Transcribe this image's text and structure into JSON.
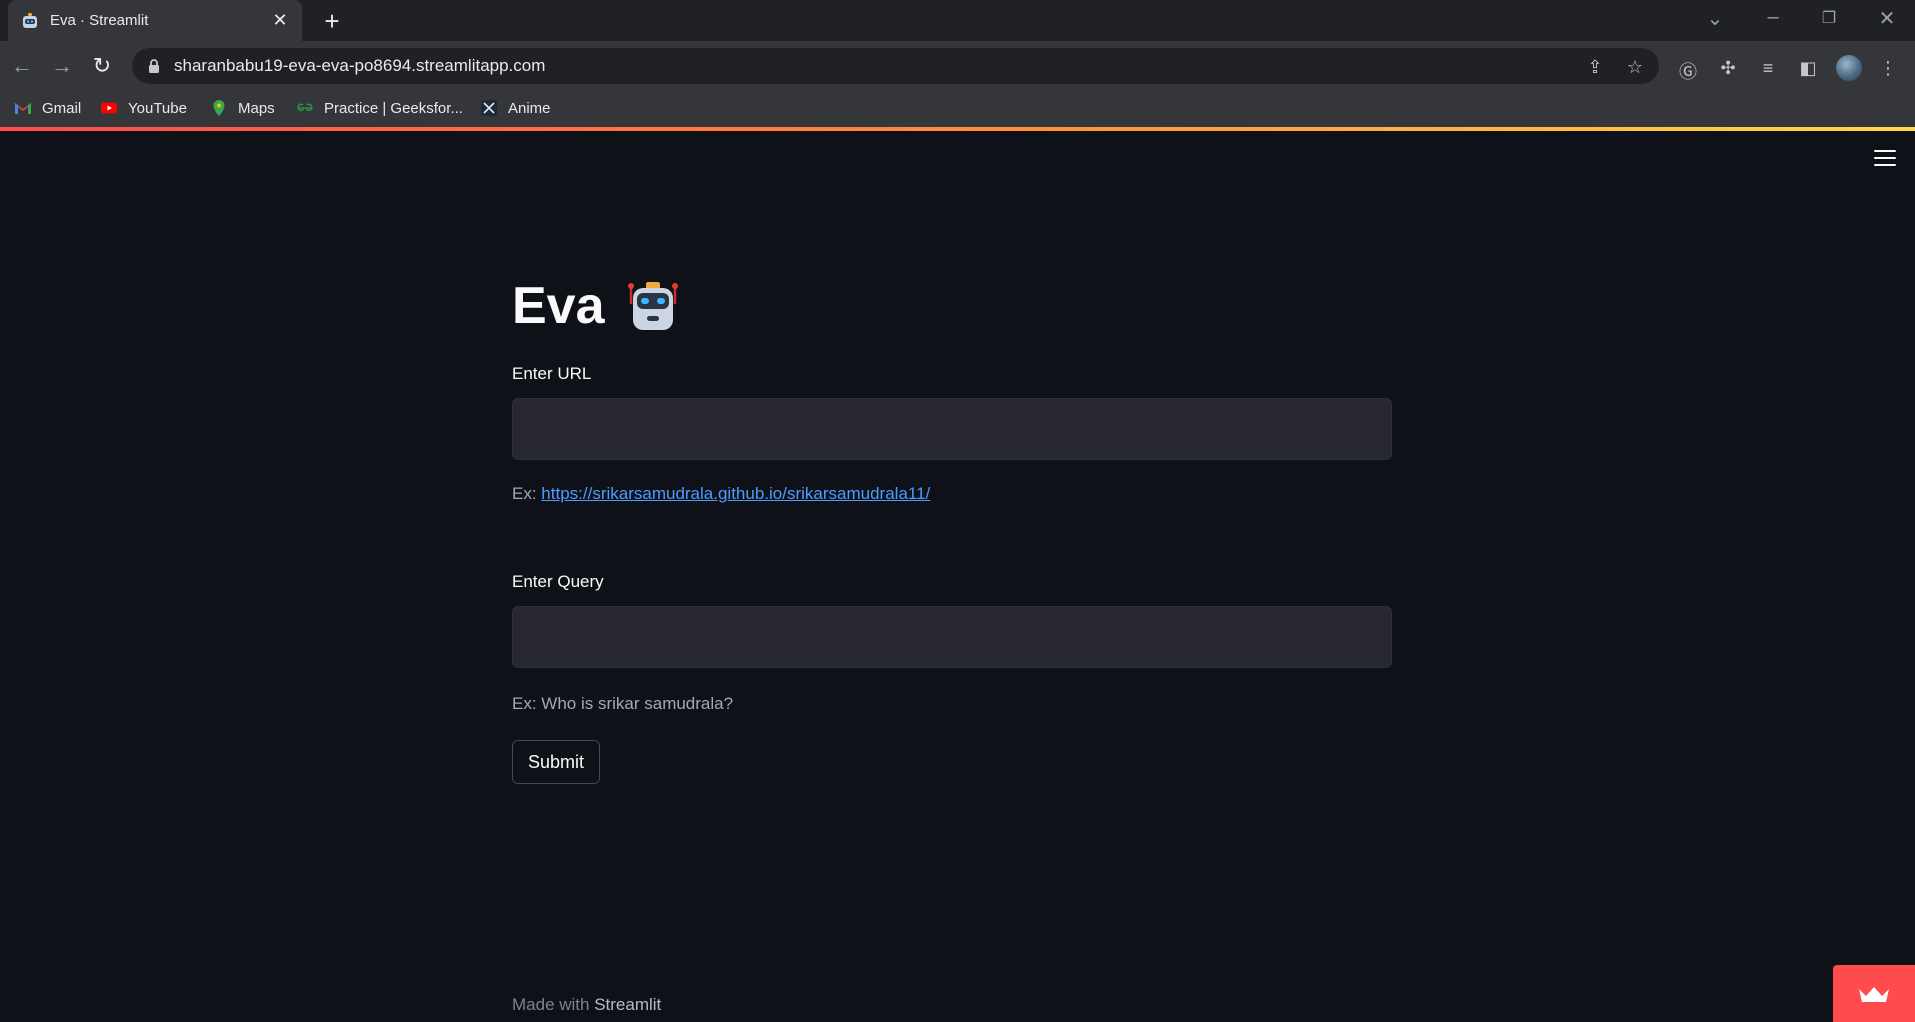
{
  "browser": {
    "tab_title": "Eva · Streamlit",
    "tab_close": "✕",
    "new_tab": "+",
    "url": "sharanbabu19-eva-eva-po8694.streamlitapp.com",
    "bookmarks": [
      {
        "label": "Gmail",
        "icon": "gmail-icon"
      },
      {
        "label": "YouTube",
        "icon": "youtube-icon"
      },
      {
        "label": "Maps",
        "icon": "maps-icon"
      },
      {
        "label": "Practice | Geeksfor...",
        "icon": "geeksforgeeks-icon"
      },
      {
        "label": "Anime",
        "icon": "anime-icon"
      }
    ],
    "colors": {
      "tabstrip": "#202124",
      "toolbar": "#35363a"
    }
  },
  "app": {
    "title": "Eva",
    "title_icon": "robot-icon",
    "url_field": {
      "label": "Enter URL",
      "value": "",
      "placeholder": ""
    },
    "url_hint_prefix": "Ex: ",
    "url_hint_link": "https://srikarsamudrala.github.io/srikarsamudrala11/",
    "query_field": {
      "label": "Enter Query",
      "value": "",
      "placeholder": ""
    },
    "query_hint": "Ex: Who is srikar samudrala?",
    "submit_label": "Submit",
    "footer_prefix": "Made with ",
    "footer_brand": "Streamlit",
    "colors": {
      "background": "#0e1117",
      "input": "#262730",
      "link": "#4e9bff",
      "accent": "#ff4b4b"
    }
  }
}
